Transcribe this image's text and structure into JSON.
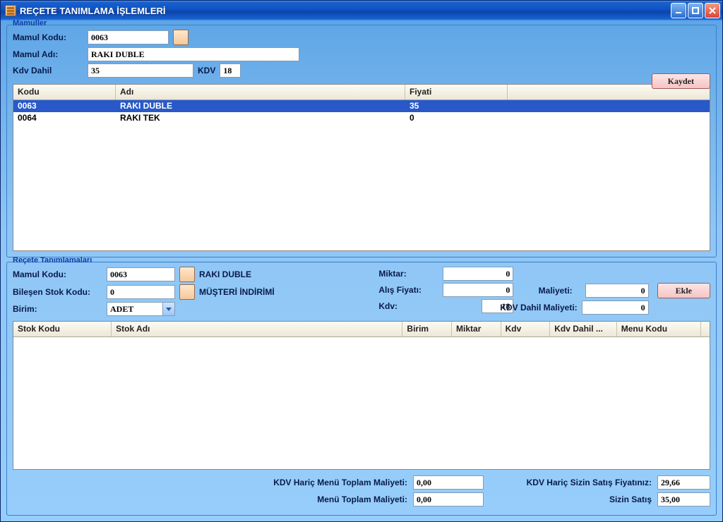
{
  "window": {
    "title": "REÇETE TANIMLAMA İŞLEMLERİ"
  },
  "mamuller": {
    "legend": "Mamuller",
    "mamul_kodu_label": "Mamul Kodu:",
    "mamul_kodu": "0063",
    "mamul_adi_label": "Mamul Adı:",
    "mamul_adi": "RAKI DUBLE",
    "kdv_dahil_label": "Kdv Dahil",
    "kdv_dahil": "35",
    "kdv_label": "KDV",
    "kdv": "18",
    "kaydet_label": "Kaydet",
    "columns": {
      "kodu": "Kodu",
      "adi": "Adı",
      "fiyati": "Fiyati"
    },
    "rows": [
      {
        "kodu": "0063",
        "adi": "RAKI DUBLE",
        "fiyati": "35",
        "selected": true
      },
      {
        "kodu": "0064",
        "adi": "RAKI TEK",
        "fiyati": "0",
        "selected": false
      }
    ]
  },
  "recete": {
    "legend": "Reçete Tanımlamaları",
    "mamul_kodu_label": "Mamul Kodu:",
    "mamul_kodu": "0063",
    "mamul_adi_display": "RAKI DUBLE",
    "bilesen_label": "Bileşen Stok Kodu:",
    "bilesen_kodu": "0",
    "bilesen_adi_display": "MÜŞTERİ İNDİRİMİ",
    "birim_label": "Birim:",
    "birim": "ADET",
    "miktar_label": "Miktar:",
    "miktar": "0",
    "alis_label": "Alış Fiyatı:",
    "alis": "0",
    "kdv_label": "Kdv:",
    "kdv": "18",
    "maliyeti_label": "Maliyeti:",
    "maliyeti": "0",
    "kdv_dahil_maliyeti_label": "KDV Dahil Maliyeti:",
    "kdv_dahil_maliyeti": "0",
    "ekle_label": "Ekle",
    "columns": {
      "stok_kodu": "Stok Kodu",
      "stok_adi": "Stok Adı",
      "birim": "Birim",
      "miktar": "Miktar",
      "kdv": "Kdv",
      "kdv_dahil": "Kdv Dahil ...",
      "menu_kodu": "Menu Kodu"
    }
  },
  "footer": {
    "kdv_haric_menu_label": "KDV Hariç Menü Toplam Maliyeti:",
    "kdv_haric_menu": "0,00",
    "menu_toplam_label": "Menü Toplam Maliyeti:",
    "menu_toplam": "0,00",
    "kdv_haric_satis_label": "KDV Hariç Sizin Satış Fiyatınız:",
    "kdv_haric_satis": "29,66",
    "sizin_satis_label": "Sizin Satış",
    "sizin_satis": "35,00"
  }
}
